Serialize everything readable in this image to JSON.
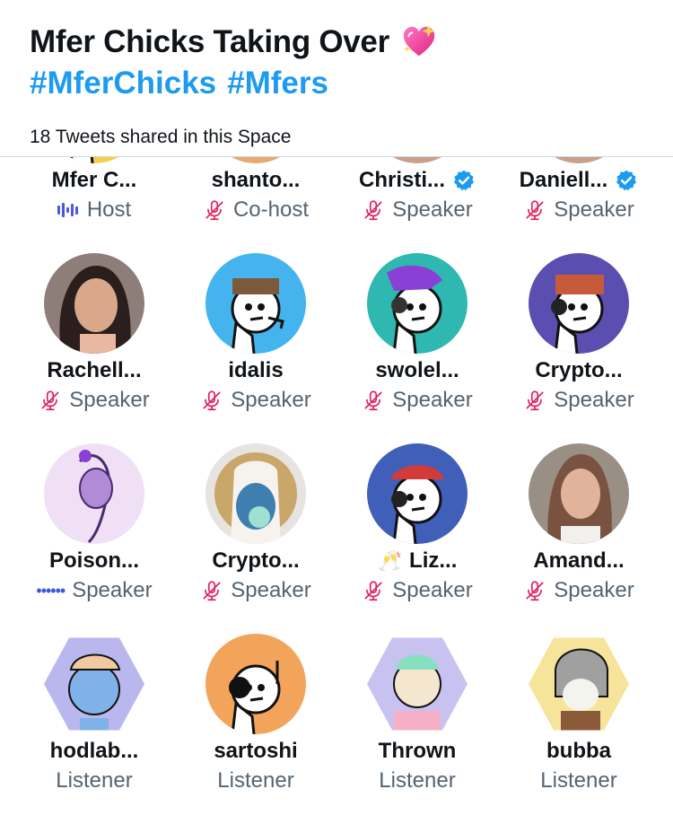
{
  "space": {
    "title": "Mfer Chicks Taking Over",
    "title_emoji": "sparkling-heart",
    "hashtags": [
      "#MferChicks",
      "#Mfers"
    ],
    "tweets_shared": "18 Tweets shared in this Space"
  },
  "colors": {
    "accent": "#1d9bf0",
    "muted": "#536471",
    "mic_off": "#e0245e",
    "speaking": "#4b59e0"
  },
  "participants": [
    {
      "name": "Mfer C...",
      "role": "Host",
      "status": "speaking",
      "verified": false,
      "avatar": "mfer-yellow"
    },
    {
      "name": "shanto...",
      "role": "Co-host",
      "status": "mic-off",
      "verified": false,
      "avatar": "skin-tan"
    },
    {
      "name": "Christi...",
      "role": "Speaker",
      "status": "mic-off",
      "verified": true,
      "avatar": "photo-woman"
    },
    {
      "name": "Daniell...",
      "role": "Speaker",
      "status": "mic-off",
      "verified": true,
      "avatar": "photo-woman"
    },
    {
      "name": "Rachell...",
      "role": "Speaker",
      "status": "mic-off",
      "verified": false,
      "avatar": "photo-rachel"
    },
    {
      "name": "idalis",
      "role": "Speaker",
      "status": "mic-off",
      "verified": false,
      "avatar": "mfer-blue"
    },
    {
      "name": "swolel...",
      "role": "Speaker",
      "status": "mic-off",
      "verified": false,
      "avatar": "mfer-teal"
    },
    {
      "name": "Crypto...",
      "role": "Speaker",
      "status": "mic-off",
      "verified": false,
      "avatar": "mfer-purple"
    },
    {
      "name": "Poison...",
      "role": "Speaker",
      "status": "connecting",
      "verified": false,
      "avatar": "purple-sketch"
    },
    {
      "name": "Crypto...",
      "role": "Speaker",
      "status": "mic-off",
      "verified": false,
      "avatar": "bubblegum"
    },
    {
      "name": "Liz...",
      "role": "Speaker",
      "status": "mic-off",
      "verified": false,
      "name_prefix": "🥂",
      "avatar": "mfer-navy"
    },
    {
      "name": "Amand...",
      "role": "Speaker",
      "status": "mic-off",
      "verified": false,
      "avatar": "photo-amanda"
    },
    {
      "name": "hodlab...",
      "role": "Listener",
      "status": "none",
      "verified": false,
      "avatar": "hex-blue"
    },
    {
      "name": "sartoshi",
      "role": "Listener",
      "status": "none",
      "verified": false,
      "avatar": "mfer-orange"
    },
    {
      "name": "Thrown",
      "role": "Listener",
      "status": "none",
      "verified": false,
      "avatar": "hex-lavender"
    },
    {
      "name": "bubba",
      "role": "Listener",
      "status": "none",
      "verified": false,
      "avatar": "hex-yellow"
    }
  ]
}
